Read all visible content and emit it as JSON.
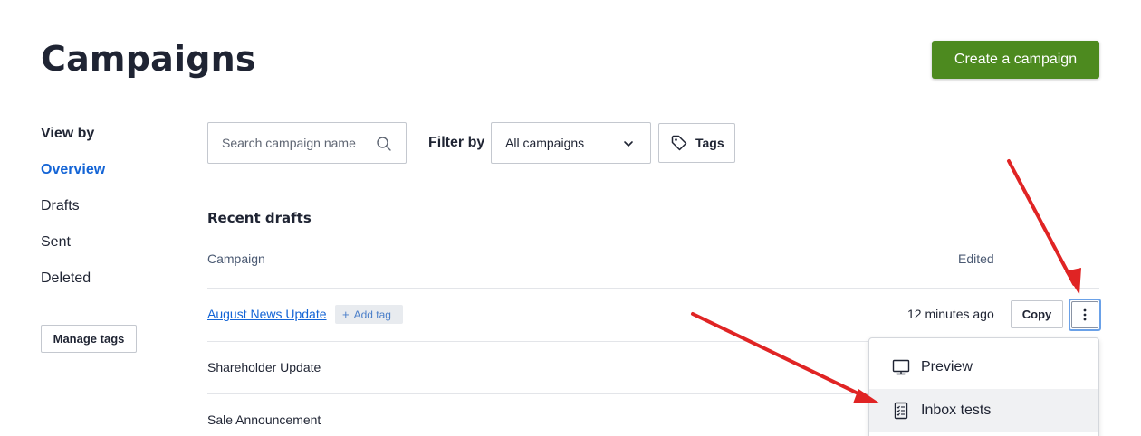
{
  "header": {
    "title": "Campaigns",
    "create_label": "Create a campaign"
  },
  "sidebar": {
    "heading": "View by",
    "items": [
      {
        "label": "Overview",
        "active": true
      },
      {
        "label": "Drafts"
      },
      {
        "label": "Sent"
      },
      {
        "label": "Deleted"
      }
    ],
    "manage_tags_label": "Manage tags"
  },
  "toolbar": {
    "search_placeholder": "Search campaign name",
    "filter_label": "Filter by",
    "filter_value": "All campaigns",
    "tags_label": "Tags"
  },
  "drafts": {
    "title": "Recent drafts",
    "columns": {
      "campaign": "Campaign",
      "edited": "Edited"
    },
    "rows": [
      {
        "name": "August News Update",
        "add_tag": "Add tag",
        "edited": "12 minutes ago",
        "copy_label": "Copy"
      },
      {
        "name": "Shareholder Update"
      },
      {
        "name": "Sale Announcement"
      }
    ]
  },
  "menu": {
    "items": [
      {
        "label": "Preview",
        "icon": "monitor-icon"
      },
      {
        "label": "Inbox tests",
        "icon": "checklist-icon"
      }
    ]
  },
  "colors": {
    "primary_green": "#4d8a1f",
    "link_blue": "#1364d6",
    "annotation_red": "#e02424"
  }
}
